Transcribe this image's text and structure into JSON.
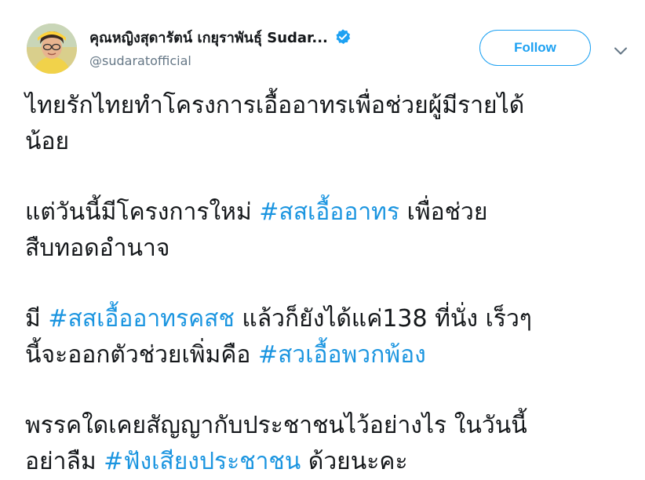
{
  "header": {
    "display_name": "คุณหญิงสุดารัตน์ เกยุราพันธุ์ Sudar...",
    "handle": "@sudaratofficial",
    "follow_label": "Follow",
    "verified_color": "#1da1f2",
    "avatar_icon": "avatar-photo",
    "more_icon": "chevron-down-icon"
  },
  "tweet": {
    "p1": {
      "line1": "ไทยรักไทยทำโครงการเอื้ออาทรเพื่อช่วยผู้มีรายได้",
      "line2": "น้อย"
    },
    "p2": {
      "pre": "แต่วันนี้มีโครงการใหม่ ",
      "tag": "#สสเอื้ออาทร",
      "post": " เพื่อช่วย",
      "line2": "สืบทอดอำนาจ"
    },
    "p3": {
      "pre": "มี ",
      "tag1": "#สสเอื้ออาทรคสช",
      "mid": " แล้วก็ยังได้แค่138 ที่นั่ง เร็วๆ",
      "line2_pre": "นี้จะออกตัวช่วยเพิ่มคือ ",
      "tag2": "#สวเอื้อพวกพ้อง"
    },
    "p4": {
      "line1": "พรรคใดเคยสัญญากับประชาชนไว้อย่างไร ในวันนี้",
      "line2_pre": "อย่าลืม ",
      "tag": "#ฟังเสียงประชาชน",
      "post": " ด้วยนะคะ"
    },
    "hashtag_color": "#1b95e0"
  }
}
